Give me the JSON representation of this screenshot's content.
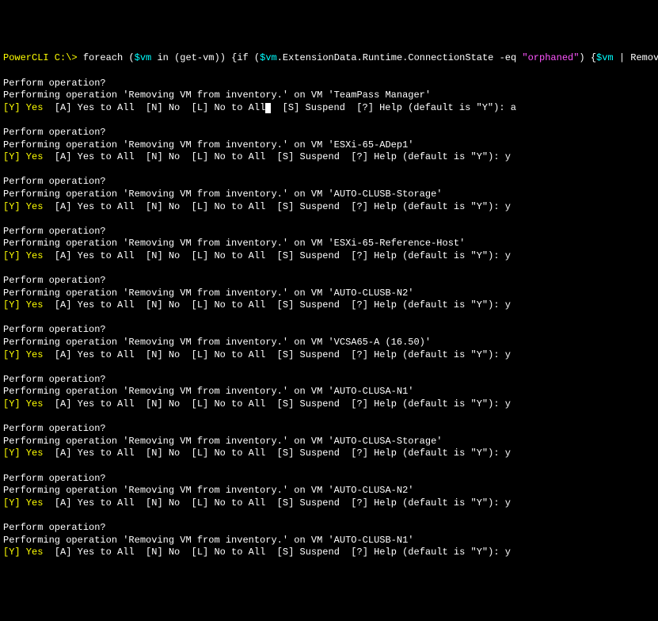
{
  "command_line": {
    "prompt": "PowerCLI C:\\>",
    "cmd": {
      "p1": "foreach",
      "p2": " (",
      "p3": "$vm",
      "p4": " in",
      "p5": " (",
      "p6": "get-vm",
      "p7": "))",
      "p8": " {",
      "p9": "if",
      "p10": " (",
      "p11": "$vm",
      "p12": ".ExtensionData.Runtime.ConnectionState",
      "p13": " -eq",
      "p14": " \"orphaned\"",
      "p15": ")",
      "p16": " {",
      "p17": "$vm",
      "p18": " |",
      "p19": " Remove-VM",
      "p20": "}}"
    }
  },
  "prompts": [
    {
      "vm": "TeamPass Manager",
      "answer": "a",
      "cursor_after_all": true
    },
    {
      "vm": "ESXi-65-ADep1",
      "answer": "y"
    },
    {
      "vm": "AUTO-CLUSB-Storage",
      "answer": "y"
    },
    {
      "vm": "ESXi-65-Reference-Host",
      "answer": "y"
    },
    {
      "vm": "AUTO-CLUSB-N2",
      "answer": "y"
    },
    {
      "vm": "VCSA65-A (16.50)",
      "answer": "y"
    },
    {
      "vm": "AUTO-CLUSA-N1",
      "answer": "y"
    },
    {
      "vm": "AUTO-CLUSA-Storage",
      "answer": "y"
    },
    {
      "vm": "AUTO-CLUSA-N2",
      "answer": "y"
    },
    {
      "vm": "AUTO-CLUSB-N1",
      "answer": "y"
    }
  ],
  "strings": {
    "perform": "Perform operation?",
    "performing_prefix": "Performing operation 'Removing VM from inventory.' on VM '",
    "performing_suffix": "'",
    "opt_yes_key": "[Y] Yes",
    "opt_all": "  [A] Yes to All  [N] No  [L] No to All",
    "opt_suspend": "  [S] Suspend  [?] Help (default is \"Y\"): "
  }
}
